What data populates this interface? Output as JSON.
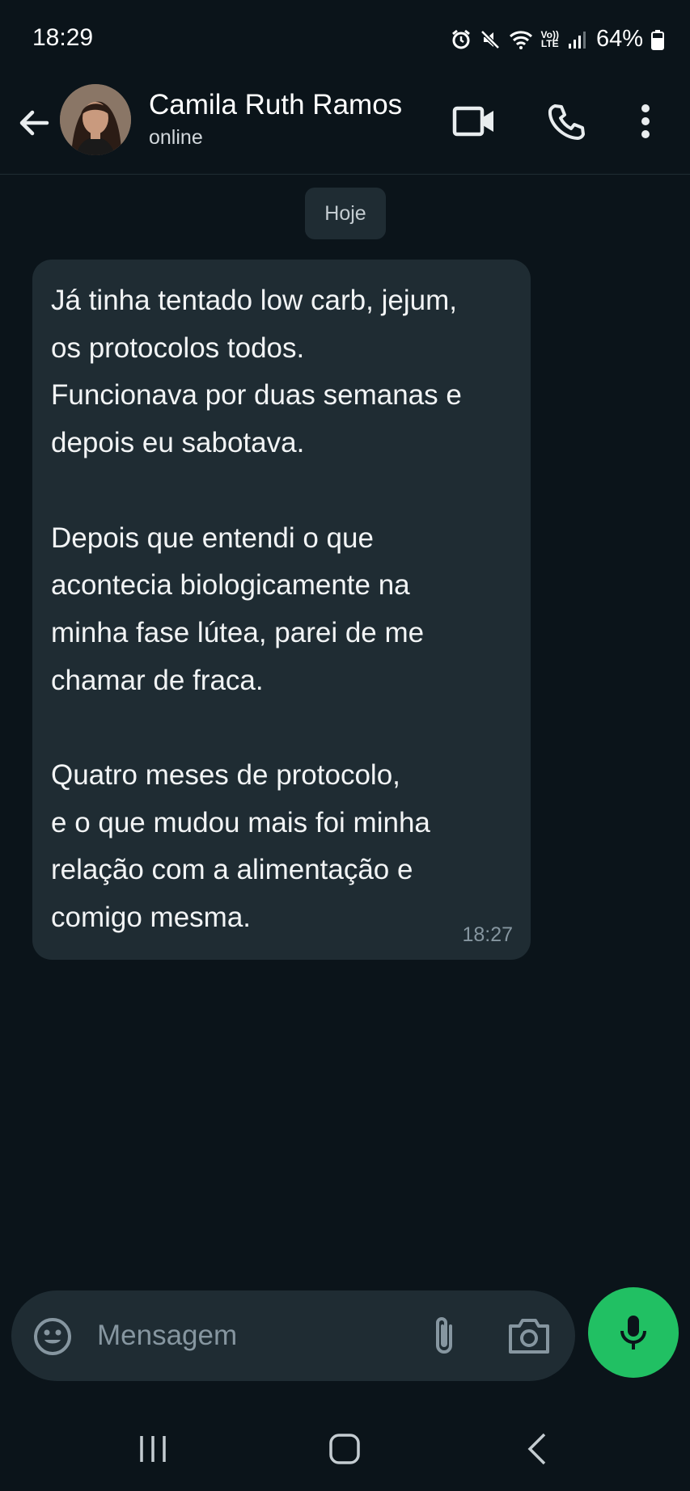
{
  "status_bar": {
    "time": "18:29",
    "lte_line1": "Vo))",
    "lte_line2": "LTE",
    "battery": "64%",
    "icons": [
      "alarm-icon",
      "mute-icon",
      "wifi-icon",
      "volte-icon",
      "signal-icon",
      "battery-icon"
    ]
  },
  "header": {
    "contact_name": "Camila Ruth Ramos",
    "contact_status": "online",
    "icons": [
      "back-arrow-icon",
      "video-call-icon",
      "phone-icon",
      "more-vert-icon"
    ]
  },
  "chat": {
    "date_divider": "Hoje",
    "messages": [
      {
        "text": "Já tinha tentado low carb, jejum,\nos protocolos todos.\nFuncionava por duas semanas e\ndepois eu sabotava.\n\nDepois que entendi o que\nacontecia biologicamente na\nminha fase lútea, parei de me\nchamar de fraca.\n\nQuatro meses de protocolo,\ne o que mudou mais foi minha\nrelação com a alimentação e\ncomigo mesma.",
        "time": "18:27",
        "direction": "incoming"
      }
    ]
  },
  "composer": {
    "placeholder": "Mensagem",
    "icons": [
      "emoji-icon",
      "attach-icon",
      "camera-icon",
      "mic-icon"
    ]
  },
  "colors": {
    "background": "#0b141a",
    "bubble": "#1f2c33",
    "accent_green": "#21c063",
    "muted_text": "#8696a0"
  }
}
